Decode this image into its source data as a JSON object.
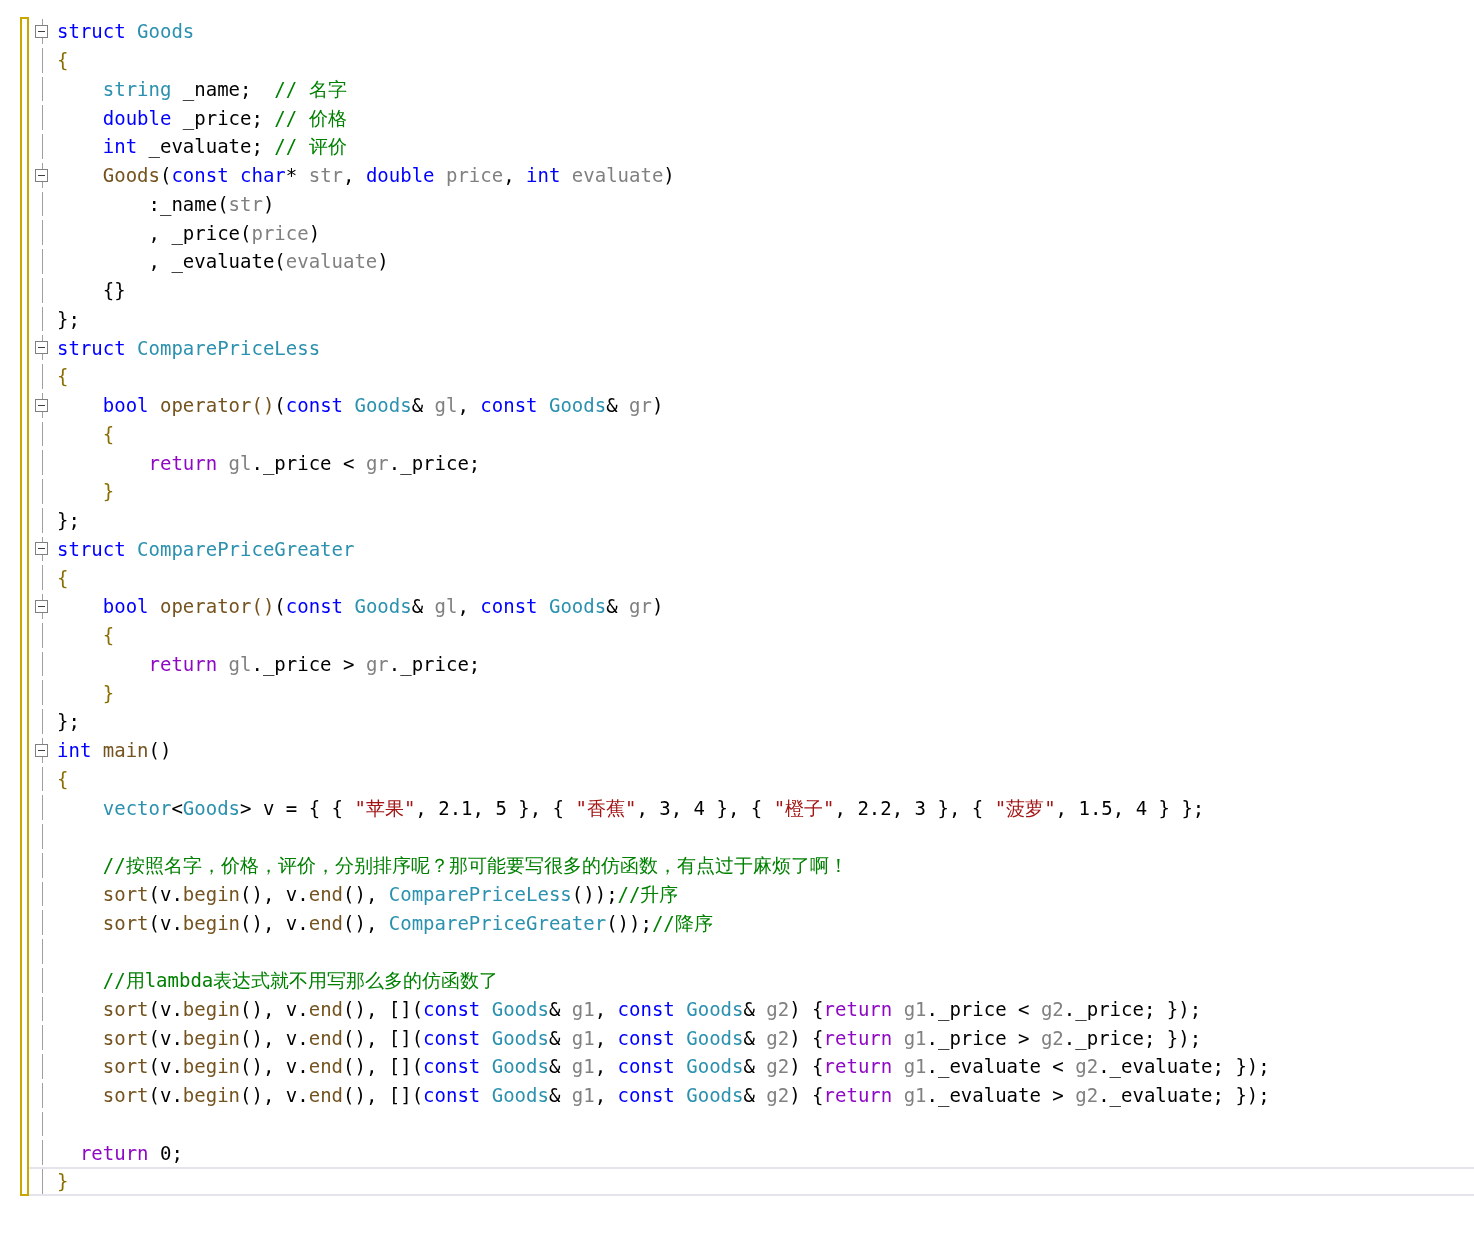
{
  "lines": [
    {
      "fold_marker": true,
      "current": false,
      "tokens": [
        {
          "t": "struct",
          "kind": "kw"
        },
        {
          "t": " Goods",
          "kind": "type"
        }
      ]
    },
    {
      "fold_marker": false,
      "current": false,
      "tokens": [
        {
          "t": "{",
          "kind": "br"
        }
      ]
    },
    {
      "fold_marker": false,
      "current": false,
      "tokens": [
        {
          "t": "    string",
          "kind": "type"
        },
        {
          "t": " _name;  ",
          "kind": "pl"
        },
        {
          "t": "// 名字",
          "kind": "cm"
        }
      ]
    },
    {
      "fold_marker": false,
      "current": false,
      "tokens": [
        {
          "t": "    double",
          "kind": "kw"
        },
        {
          "t": " _price; ",
          "kind": "pl"
        },
        {
          "t": "// 价格",
          "kind": "cm"
        }
      ]
    },
    {
      "fold_marker": false,
      "current": false,
      "tokens": [
        {
          "t": "    int",
          "kind": "kw"
        },
        {
          "t": " _evaluate; ",
          "kind": "pl"
        },
        {
          "t": "// 评价",
          "kind": "cm"
        }
      ]
    },
    {
      "fold_marker": true,
      "current": false,
      "tokens": [
        {
          "t": "    Goods",
          "kind": "fn"
        },
        {
          "t": "(",
          "kind": "pl"
        },
        {
          "t": "const char",
          "kind": "kw"
        },
        {
          "t": "* ",
          "kind": "pl"
        },
        {
          "t": "str",
          "kind": "param"
        },
        {
          "t": ", ",
          "kind": "pl"
        },
        {
          "t": "double",
          "kind": "kw"
        },
        {
          "t": " price",
          "kind": "param"
        },
        {
          "t": ", ",
          "kind": "pl"
        },
        {
          "t": "int",
          "kind": "kw"
        },
        {
          "t": " evaluate",
          "kind": "param"
        },
        {
          "t": ")",
          "kind": "pl"
        }
      ]
    },
    {
      "fold_marker": false,
      "current": false,
      "tokens": [
        {
          "t": "        :_name(",
          "kind": "pl"
        },
        {
          "t": "str",
          "kind": "param"
        },
        {
          "t": ")",
          "kind": "pl"
        }
      ]
    },
    {
      "fold_marker": false,
      "current": false,
      "tokens": [
        {
          "t": "        , _price(",
          "kind": "pl"
        },
        {
          "t": "price",
          "kind": "param"
        },
        {
          "t": ")",
          "kind": "pl"
        }
      ]
    },
    {
      "fold_marker": false,
      "current": false,
      "tokens": [
        {
          "t": "        , _evaluate(",
          "kind": "pl"
        },
        {
          "t": "evaluate",
          "kind": "param"
        },
        {
          "t": ")",
          "kind": "pl"
        }
      ]
    },
    {
      "fold_marker": false,
      "current": false,
      "tokens": [
        {
          "t": "    {}",
          "kind": "pl"
        }
      ]
    },
    {
      "fold_marker": false,
      "current": false,
      "tokens": [
        {
          "t": "};",
          "kind": "pl"
        }
      ]
    },
    {
      "fold_marker": true,
      "current": false,
      "tokens": [
        {
          "t": "struct",
          "kind": "kw"
        },
        {
          "t": " ComparePriceLess",
          "kind": "type"
        }
      ]
    },
    {
      "fold_marker": false,
      "current": false,
      "tokens": [
        {
          "t": "{",
          "kind": "br"
        }
      ]
    },
    {
      "fold_marker": true,
      "current": false,
      "tokens": [
        {
          "t": "    bool",
          "kind": "kw"
        },
        {
          "t": " operator()",
          "kind": "fn"
        },
        {
          "t": "(",
          "kind": "pl"
        },
        {
          "t": "const",
          "kind": "kw"
        },
        {
          "t": " Goods",
          "kind": "type"
        },
        {
          "t": "& ",
          "kind": "pl"
        },
        {
          "t": "gl",
          "kind": "param"
        },
        {
          "t": ", ",
          "kind": "pl"
        },
        {
          "t": "const",
          "kind": "kw"
        },
        {
          "t": " Goods",
          "kind": "type"
        },
        {
          "t": "& ",
          "kind": "pl"
        },
        {
          "t": "gr",
          "kind": "param"
        },
        {
          "t": ")",
          "kind": "pl"
        }
      ]
    },
    {
      "fold_marker": false,
      "current": false,
      "tokens": [
        {
          "t": "    {",
          "kind": "br"
        }
      ]
    },
    {
      "fold_marker": false,
      "current": false,
      "tokens": [
        {
          "t": "        return",
          "kind": "ctl"
        },
        {
          "t": " gl",
          "kind": "param"
        },
        {
          "t": "._price < ",
          "kind": "pl"
        },
        {
          "t": "gr",
          "kind": "param"
        },
        {
          "t": "._price;",
          "kind": "pl"
        }
      ]
    },
    {
      "fold_marker": false,
      "current": false,
      "tokens": [
        {
          "t": "    }",
          "kind": "br"
        }
      ]
    },
    {
      "fold_marker": false,
      "current": false,
      "tokens": [
        {
          "t": "};",
          "kind": "pl"
        }
      ]
    },
    {
      "fold_marker": true,
      "current": false,
      "tokens": [
        {
          "t": "struct",
          "kind": "kw"
        },
        {
          "t": " ComparePriceGreater",
          "kind": "type"
        }
      ]
    },
    {
      "fold_marker": false,
      "current": false,
      "tokens": [
        {
          "t": "{",
          "kind": "br"
        }
      ]
    },
    {
      "fold_marker": true,
      "current": false,
      "tokens": [
        {
          "t": "    bool",
          "kind": "kw"
        },
        {
          "t": " operator()",
          "kind": "fn"
        },
        {
          "t": "(",
          "kind": "pl"
        },
        {
          "t": "const",
          "kind": "kw"
        },
        {
          "t": " Goods",
          "kind": "type"
        },
        {
          "t": "& ",
          "kind": "pl"
        },
        {
          "t": "gl",
          "kind": "param"
        },
        {
          "t": ", ",
          "kind": "pl"
        },
        {
          "t": "const",
          "kind": "kw"
        },
        {
          "t": " Goods",
          "kind": "type"
        },
        {
          "t": "& ",
          "kind": "pl"
        },
        {
          "t": "gr",
          "kind": "param"
        },
        {
          "t": ")",
          "kind": "pl"
        }
      ]
    },
    {
      "fold_marker": false,
      "current": false,
      "tokens": [
        {
          "t": "    {",
          "kind": "br"
        }
      ]
    },
    {
      "fold_marker": false,
      "current": false,
      "tokens": [
        {
          "t": "        return",
          "kind": "ctl"
        },
        {
          "t": " gl",
          "kind": "param"
        },
        {
          "t": "._price > ",
          "kind": "pl"
        },
        {
          "t": "gr",
          "kind": "param"
        },
        {
          "t": "._price;",
          "kind": "pl"
        }
      ]
    },
    {
      "fold_marker": false,
      "current": false,
      "tokens": [
        {
          "t": "    }",
          "kind": "br"
        }
      ]
    },
    {
      "fold_marker": false,
      "current": false,
      "tokens": [
        {
          "t": "};",
          "kind": "pl"
        }
      ]
    },
    {
      "fold_marker": true,
      "current": false,
      "tokens": [
        {
          "t": "int",
          "kind": "kw"
        },
        {
          "t": " main",
          "kind": "fn"
        },
        {
          "t": "()",
          "kind": "pl"
        }
      ]
    },
    {
      "fold_marker": false,
      "current": false,
      "tokens": [
        {
          "t": "{",
          "kind": "br"
        }
      ]
    },
    {
      "fold_marker": false,
      "current": false,
      "tokens": [
        {
          "t": "    vector",
          "kind": "type"
        },
        {
          "t": "<",
          "kind": "pl"
        },
        {
          "t": "Goods",
          "kind": "type"
        },
        {
          "t": "> v = { { ",
          "kind": "pl"
        },
        {
          "t": "\"苹果\"",
          "kind": "str"
        },
        {
          "t": ", 2.1, 5 }, { ",
          "kind": "pl"
        },
        {
          "t": "\"香蕉\"",
          "kind": "str"
        },
        {
          "t": ", 3, 4 }, { ",
          "kind": "pl"
        },
        {
          "t": "\"橙子\"",
          "kind": "str"
        },
        {
          "t": ", 2.2, 3 }, { ",
          "kind": "pl"
        },
        {
          "t": "\"菠萝\"",
          "kind": "str"
        },
        {
          "t": ", 1.5, 4 } };",
          "kind": "pl"
        }
      ]
    },
    {
      "fold_marker": false,
      "current": false
    },
    {
      "fold_marker": false,
      "current": false,
      "tokens": [
        {
          "t": "    //按照名字，价格，评价，分别排序呢？那可能要写很多的仿函数，有点过于麻烦了啊！",
          "kind": "cm"
        }
      ]
    },
    {
      "fold_marker": false,
      "current": false,
      "tokens": [
        {
          "t": "    sort",
          "kind": "fn"
        },
        {
          "t": "(v.",
          "kind": "pl"
        },
        {
          "t": "begin",
          "kind": "fn"
        },
        {
          "t": "(), v.",
          "kind": "pl"
        },
        {
          "t": "end",
          "kind": "fn"
        },
        {
          "t": "(), ",
          "kind": "pl"
        },
        {
          "t": "ComparePriceLess",
          "kind": "type"
        },
        {
          "t": "());",
          "kind": "pl"
        },
        {
          "t": "//升序",
          "kind": "cm"
        }
      ]
    },
    {
      "fold_marker": false,
      "current": false,
      "tokens": [
        {
          "t": "    sort",
          "kind": "fn"
        },
        {
          "t": "(v.",
          "kind": "pl"
        },
        {
          "t": "begin",
          "kind": "fn"
        },
        {
          "t": "(), v.",
          "kind": "pl"
        },
        {
          "t": "end",
          "kind": "fn"
        },
        {
          "t": "(), ",
          "kind": "pl"
        },
        {
          "t": "ComparePriceGreater",
          "kind": "type"
        },
        {
          "t": "());",
          "kind": "pl"
        },
        {
          "t": "//降序",
          "kind": "cm"
        }
      ]
    },
    {
      "fold_marker": false,
      "current": false
    },
    {
      "fold_marker": false,
      "current": false,
      "tokens": [
        {
          "t": "    //用lambda表达式就不用写那么多的仿函数了",
          "kind": "cm"
        }
      ]
    },
    {
      "fold_marker": false,
      "current": false,
      "tokens": [
        {
          "t": "    sort",
          "kind": "fn"
        },
        {
          "t": "(v.",
          "kind": "pl"
        },
        {
          "t": "begin",
          "kind": "fn"
        },
        {
          "t": "(), v.",
          "kind": "pl"
        },
        {
          "t": "end",
          "kind": "fn"
        },
        {
          "t": "(), [](",
          "kind": "pl"
        },
        {
          "t": "const",
          "kind": "kw"
        },
        {
          "t": " Goods",
          "kind": "type"
        },
        {
          "t": "& ",
          "kind": "pl"
        },
        {
          "t": "g1",
          "kind": "param"
        },
        {
          "t": ", ",
          "kind": "pl"
        },
        {
          "t": "const",
          "kind": "kw"
        },
        {
          "t": " Goods",
          "kind": "type"
        },
        {
          "t": "& ",
          "kind": "pl"
        },
        {
          "t": "g2",
          "kind": "param"
        },
        {
          "t": ") {",
          "kind": "pl"
        },
        {
          "t": "return",
          "kind": "ctl"
        },
        {
          "t": " g1",
          "kind": "param"
        },
        {
          "t": "._price < ",
          "kind": "pl"
        },
        {
          "t": "g2",
          "kind": "param"
        },
        {
          "t": "._price; });",
          "kind": "pl"
        }
      ]
    },
    {
      "fold_marker": false,
      "current": false,
      "tokens": [
        {
          "t": "    sort",
          "kind": "fn"
        },
        {
          "t": "(v.",
          "kind": "pl"
        },
        {
          "t": "begin",
          "kind": "fn"
        },
        {
          "t": "(), v.",
          "kind": "pl"
        },
        {
          "t": "end",
          "kind": "fn"
        },
        {
          "t": "(), [](",
          "kind": "pl"
        },
        {
          "t": "const",
          "kind": "kw"
        },
        {
          "t": " Goods",
          "kind": "type"
        },
        {
          "t": "& ",
          "kind": "pl"
        },
        {
          "t": "g1",
          "kind": "param"
        },
        {
          "t": ", ",
          "kind": "pl"
        },
        {
          "t": "const",
          "kind": "kw"
        },
        {
          "t": " Goods",
          "kind": "type"
        },
        {
          "t": "& ",
          "kind": "pl"
        },
        {
          "t": "g2",
          "kind": "param"
        },
        {
          "t": ") {",
          "kind": "pl"
        },
        {
          "t": "return",
          "kind": "ctl"
        },
        {
          "t": " g1",
          "kind": "param"
        },
        {
          "t": "._price > ",
          "kind": "pl"
        },
        {
          "t": "g2",
          "kind": "param"
        },
        {
          "t": "._price; });",
          "kind": "pl"
        }
      ]
    },
    {
      "fold_marker": false,
      "current": false,
      "tokens": [
        {
          "t": "    sort",
          "kind": "fn"
        },
        {
          "t": "(v.",
          "kind": "pl"
        },
        {
          "t": "begin",
          "kind": "fn"
        },
        {
          "t": "(), v.",
          "kind": "pl"
        },
        {
          "t": "end",
          "kind": "fn"
        },
        {
          "t": "(), [](",
          "kind": "pl"
        },
        {
          "t": "const",
          "kind": "kw"
        },
        {
          "t": " Goods",
          "kind": "type"
        },
        {
          "t": "& ",
          "kind": "pl"
        },
        {
          "t": "g1",
          "kind": "param"
        },
        {
          "t": ", ",
          "kind": "pl"
        },
        {
          "t": "const",
          "kind": "kw"
        },
        {
          "t": " Goods",
          "kind": "type"
        },
        {
          "t": "& ",
          "kind": "pl"
        },
        {
          "t": "g2",
          "kind": "param"
        },
        {
          "t": ") {",
          "kind": "pl"
        },
        {
          "t": "return",
          "kind": "ctl"
        },
        {
          "t": " g1",
          "kind": "param"
        },
        {
          "t": "._evaluate < ",
          "kind": "pl"
        },
        {
          "t": "g2",
          "kind": "param"
        },
        {
          "t": "._evaluate; });",
          "kind": "pl"
        }
      ]
    },
    {
      "fold_marker": false,
      "current": false,
      "tokens": [
        {
          "t": "    sort",
          "kind": "fn"
        },
        {
          "t": "(v.",
          "kind": "pl"
        },
        {
          "t": "begin",
          "kind": "fn"
        },
        {
          "t": "(), v.",
          "kind": "pl"
        },
        {
          "t": "end",
          "kind": "fn"
        },
        {
          "t": "(), [](",
          "kind": "pl"
        },
        {
          "t": "const",
          "kind": "kw"
        },
        {
          "t": " Goods",
          "kind": "type"
        },
        {
          "t": "& ",
          "kind": "pl"
        },
        {
          "t": "g1",
          "kind": "param"
        },
        {
          "t": ", ",
          "kind": "pl"
        },
        {
          "t": "const",
          "kind": "kw"
        },
        {
          "t": " Goods",
          "kind": "type"
        },
        {
          "t": "& ",
          "kind": "pl"
        },
        {
          "t": "g2",
          "kind": "param"
        },
        {
          "t": ") {",
          "kind": "pl"
        },
        {
          "t": "return",
          "kind": "ctl"
        },
        {
          "t": " g1",
          "kind": "param"
        },
        {
          "t": "._evaluate > ",
          "kind": "pl"
        },
        {
          "t": "g2",
          "kind": "param"
        },
        {
          "t": "._evaluate; });",
          "kind": "pl"
        }
      ]
    },
    {
      "fold_marker": false,
      "current": false
    },
    {
      "fold_marker": false,
      "current": false,
      "tokens": [
        {
          "t": "  return",
          "kind": "ctl"
        },
        {
          "t": " 0;",
          "kind": "pl"
        }
      ]
    },
    {
      "fold_marker": false,
      "current": true,
      "tokens": [
        {
          "t": "}",
          "kind": "br"
        }
      ]
    }
  ]
}
